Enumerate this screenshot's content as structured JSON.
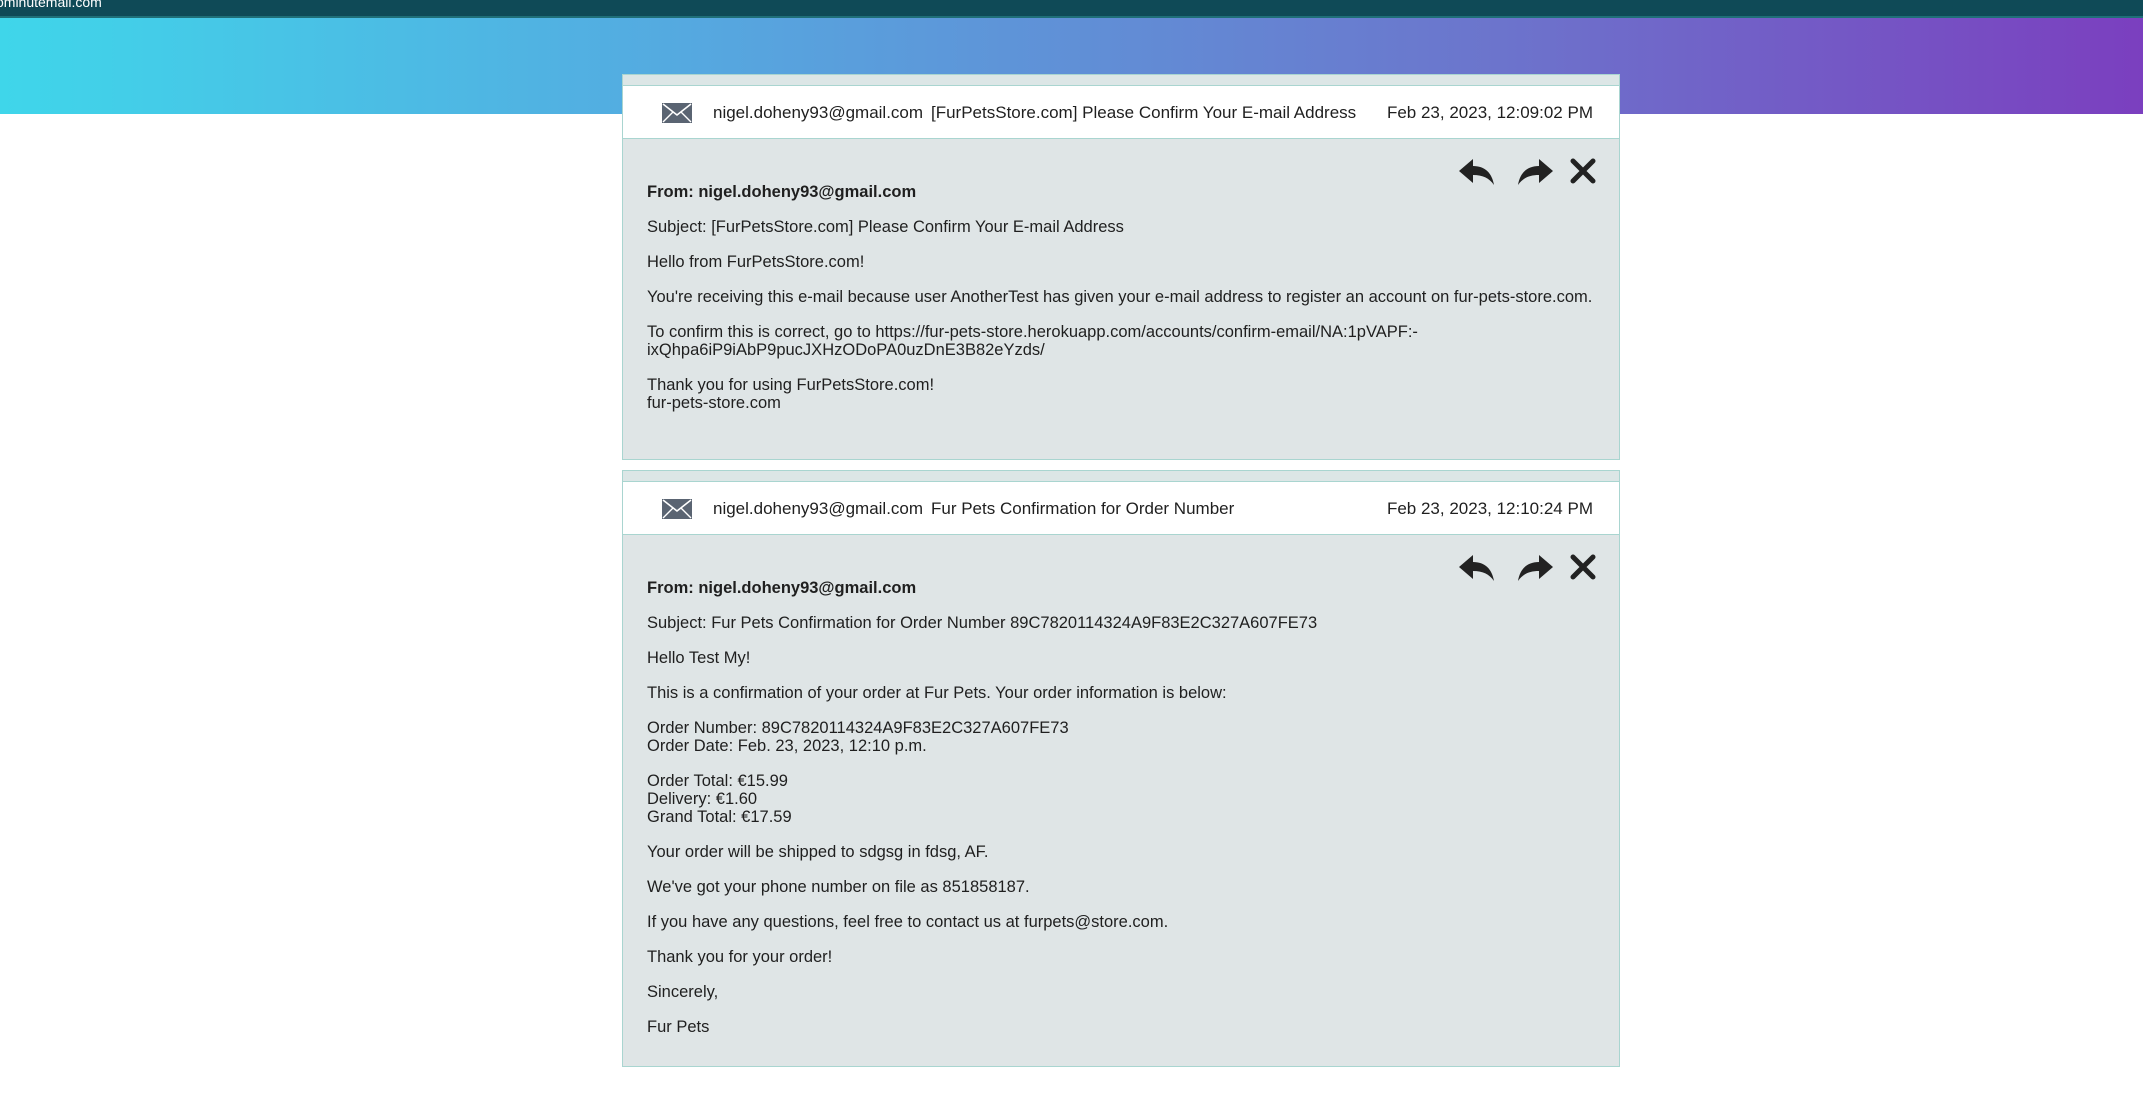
{
  "site": "ominutemail.com",
  "colors": {
    "accent_start": "#3fd6ea",
    "accent_end": "#7b3fbf",
    "topbar": "#0f4a57"
  },
  "emails": [
    {
      "from": "nigel.doheny93@gmail.com",
      "subject": "[FurPetsStore.com] Please Confirm Your E-mail Address",
      "date": "Feb 23, 2023, 12:09:02 PM",
      "from_line": "From: nigel.doheny93@gmail.com",
      "subject_line": "Subject: [FurPetsStore.com] Please Confirm Your E-mail Address",
      "body": [
        "Hello from FurPetsStore.com!",
        "You're receiving this e-mail because user AnotherTest has given your e-mail address to register an account on fur-pets-store.com.",
        "To confirm this is correct, go to https://fur-pets-store.herokuapp.com/accounts/confirm-email/NA:1pVAPF:-",
        "ixQhpa6iP9iAbP9pucJXHzODoPA0uzDnE3B82eYzds/",
        "Thank you for using FurPetsStore.com!",
        "fur-pets-store.com"
      ]
    },
    {
      "from": "nigel.doheny93@gmail.com",
      "subject": "Fur Pets Confirmation for Order Number",
      "date": "Feb 23, 2023, 12:10:24 PM",
      "from_line": "From: nigel.doheny93@gmail.com",
      "subject_line": "Subject: Fur Pets Confirmation for Order Number 89C7820114324A9F83E2C327A607FE73",
      "body": [
        "Hello Test My!",
        "This is a confirmation of your order at Fur Pets. Your order information is below:",
        "Order Number: 89C7820114324A9F83E2C327A607FE73",
        "Order Date: Feb. 23, 2023, 12:10 p.m.",
        "Order Total: €15.99",
        "Delivery: €1.60",
        "Grand Total: €17.59",
        "Your order will be shipped to sdgsg in fdsg, AF.",
        "We've got your phone number on file as 851858187.",
        "If you have any questions, feel free to contact us at furpets@store.com.",
        "Thank you for your order!",
        "Sincerely,",
        "Fur Pets"
      ]
    }
  ],
  "icons": {
    "envelope": "envelope-icon",
    "reply": "reply-icon",
    "forward": "forward-icon",
    "close": "close-icon"
  }
}
